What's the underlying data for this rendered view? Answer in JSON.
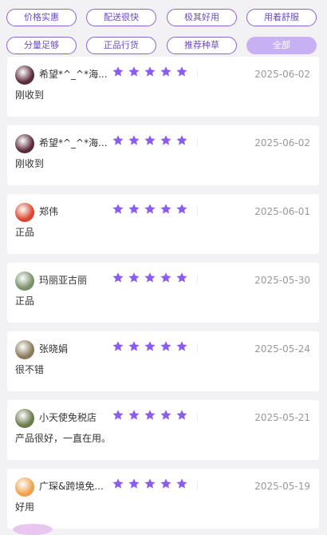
{
  "filter_tags": [
    {
      "label": "价格实惠",
      "active": false
    },
    {
      "label": "配送很快",
      "active": false
    },
    {
      "label": "极其好用",
      "active": false
    },
    {
      "label": "用着舒服",
      "active": false
    },
    {
      "label": "分量足够",
      "active": false
    },
    {
      "label": "正品行货",
      "active": false
    },
    {
      "label": "推荐种草",
      "active": false
    },
    {
      "label": "全部",
      "active": true
    }
  ],
  "reviews": [
    {
      "user": "希望*^_^*海...",
      "rating": 5,
      "date": "2025-06-02",
      "content": "刚收到",
      "avatar_color": "#5a2a3a"
    },
    {
      "user": "希望*^_^*海...",
      "rating": 5,
      "date": "2025-06-02",
      "content": "刚收到",
      "avatar_color": "#5a2a3a"
    },
    {
      "user": "郑伟",
      "rating": 5,
      "date": "2025-06-01",
      "content": "正品",
      "avatar_color": "#d9452f"
    },
    {
      "user": "玛丽亚古丽",
      "rating": 5,
      "date": "2025-05-30",
      "content": "正品",
      "avatar_color": "#7a8f6a"
    },
    {
      "user": "张晓娟",
      "rating": 5,
      "date": "2025-05-24",
      "content": "很不错",
      "avatar_color": "#8a7a5a"
    },
    {
      "user": "小天使免税店",
      "rating": 5,
      "date": "2025-05-21",
      "content": "产品很好，一直在用。",
      "avatar_color": "#6a7a4a"
    },
    {
      "user": "广琛&跨境免...",
      "rating": 5,
      "date": "2025-05-19",
      "content": "好用",
      "avatar_color": "#f0a04a"
    }
  ],
  "colors": {
    "accent": "#8a5cf0",
    "tag_border": "#8a63d2",
    "active_tag": "#c8b0f5"
  }
}
